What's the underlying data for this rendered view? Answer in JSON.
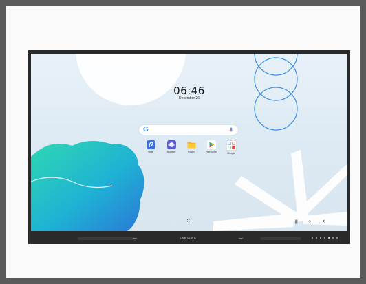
{
  "lockscreen": {
    "time": "06:46",
    "date": "December 26"
  },
  "search_bar": {
    "logo": "G",
    "logo_icon": "google-g-icon",
    "mic_icon": "microphone-icon"
  },
  "apps": [
    {
      "label": "Note",
      "icon": "note-pen-icon",
      "color": "#3f6fe0"
    },
    {
      "label": "Browser",
      "icon": "browser-planet-icon",
      "color": "#5b5bd6"
    },
    {
      "label": "Finder",
      "icon": "folder-icon",
      "color": "#f6b818"
    },
    {
      "label": "Play Store",
      "icon": "play-store-icon",
      "color": "#ffffff"
    },
    {
      "label": "Google",
      "icon": "google-folder-icon",
      "color": "#ffffff"
    }
  ],
  "navigation": {
    "recent_icon": "recent-apps-icon",
    "recent_glyph": "|||",
    "home_icon": "home-icon",
    "home_glyph": "○",
    "back_icon": "back-icon",
    "back_glyph": "<",
    "drawer_icon": "app-drawer-icon"
  },
  "monitor": {
    "brand": "SAMSUNG"
  },
  "colors": {
    "wallpaper_top": "#e8f1f8",
    "wave_teal": "#2fd6b4",
    "wave_blue": "#2a8fe0",
    "ring_blue": "#3c8fe0",
    "bezel": "#2a2a2b"
  }
}
